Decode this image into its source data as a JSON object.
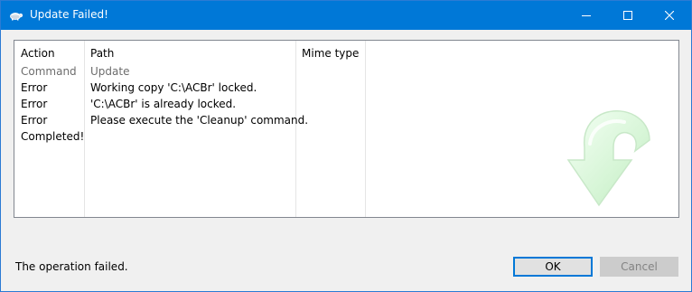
{
  "window": {
    "title": "Update Failed!"
  },
  "titlebar_buttons": [
    "minimize-icon",
    "maximize-icon",
    "close-icon"
  ],
  "table": {
    "headers": [
      "Action",
      "Path",
      "Mime type"
    ],
    "rows": [
      {
        "action": "Command",
        "path": "Update",
        "muted": true
      },
      {
        "action": "Error",
        "path": "Working copy 'C:\\ACBr' locked."
      },
      {
        "action": "Error",
        "path": "'C:\\ACBr' is already locked."
      },
      {
        "action": "Error",
        "path": "Please execute the 'Cleanup' command."
      },
      {
        "action": "Completed!",
        "path": ""
      }
    ],
    "watermark_icon": "update-arrow-icon"
  },
  "footer": {
    "status": "The operation failed.",
    "ok_label": "OK",
    "cancel_label": "Cancel"
  },
  "colors": {
    "titlebar": "#0078d7",
    "accent": "#0078d7",
    "muted_text": "#6d6d6d"
  }
}
